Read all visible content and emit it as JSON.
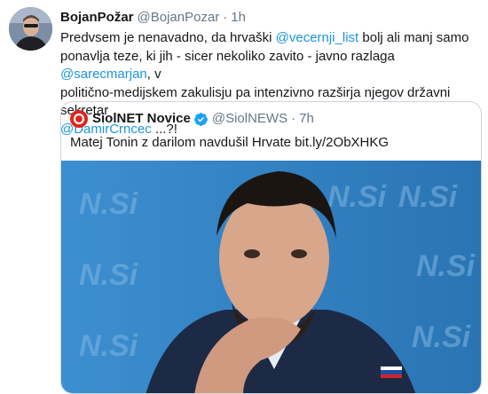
{
  "tweet": {
    "author_name": "BojanPožar",
    "author_handle": "@BojanPozar",
    "separator": "·",
    "time": "1h",
    "text": {
      "l1a": "Predvsem je nenavadno, da hrvaški ",
      "l1link": "@vecernji_list",
      "l1b": " bolj ali manj samo",
      "l2a": "ponavlja teze, ki jih - sicer nekoliko zavito - javno razlaga ",
      "l2link": "@sarecmarjan",
      "l2b": ", v",
      "l3": "politično-medijskem zakulisju pa intenzivno razširja njegov državni sekretar",
      "l4link": "@DamirCrncec",
      "l4b": " ...?!"
    }
  },
  "quoted_tweet": {
    "author_name": "SiolNET Novice",
    "author_handle": "@SiolNEWS",
    "separator": "·",
    "time": "7h",
    "text": "Matej Tonin z darilom navdušil Hrvate bit.ly/2ObXHKG",
    "backdrop_text": "N.Si"
  },
  "colors": {
    "link": "#1b95e0",
    "verified": "#1da1f2",
    "photo_background": "#2f7fbe"
  },
  "icons": [
    "verified-badge-icon"
  ]
}
